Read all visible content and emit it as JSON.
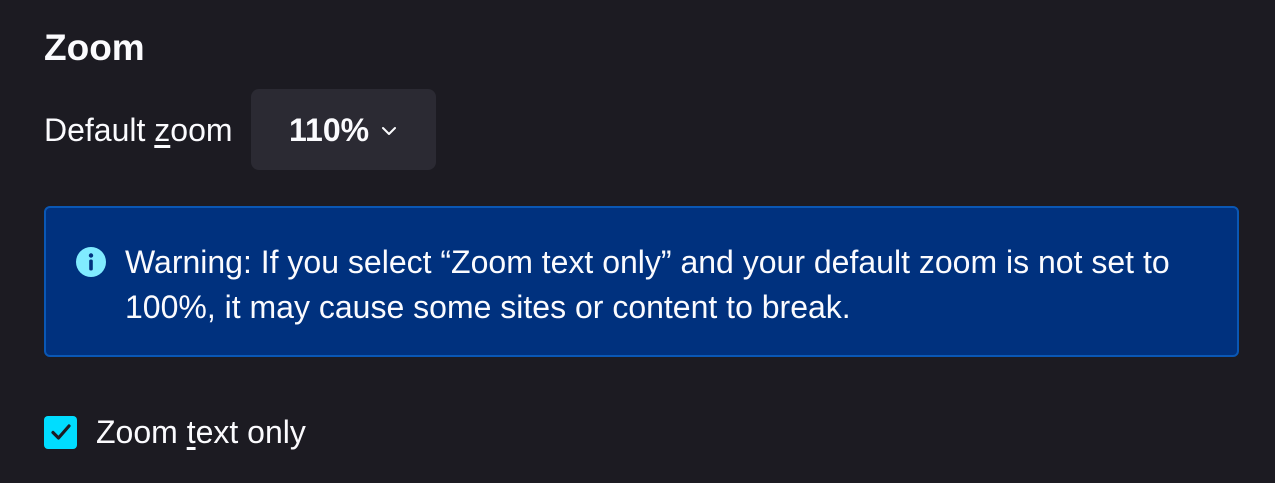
{
  "zoom_section": {
    "title": "Zoom",
    "default_zoom": {
      "label_pre": "Default ",
      "label_key": "z",
      "label_post": "oom",
      "selected_value": "110%",
      "dropdown_icon": "chevron-down-icon"
    },
    "warning": {
      "icon": "info-icon",
      "text": "Warning: If you select “Zoom text only” and your default zoom is not set to 100%, it may cause some sites or content to break."
    },
    "zoom_text_only": {
      "label_pre": "Zoom ",
      "label_key": "t",
      "label_post": "ext only",
      "checked": true
    }
  },
  "colors": {
    "background": "#1c1b22",
    "select_bg": "#2b2a33",
    "warning_bg": "#00317e",
    "warning_border": "#0a57b4",
    "info_icon": "#80ebff",
    "checkbox_accent": "#00ddff",
    "text": "#fbfbfe"
  }
}
